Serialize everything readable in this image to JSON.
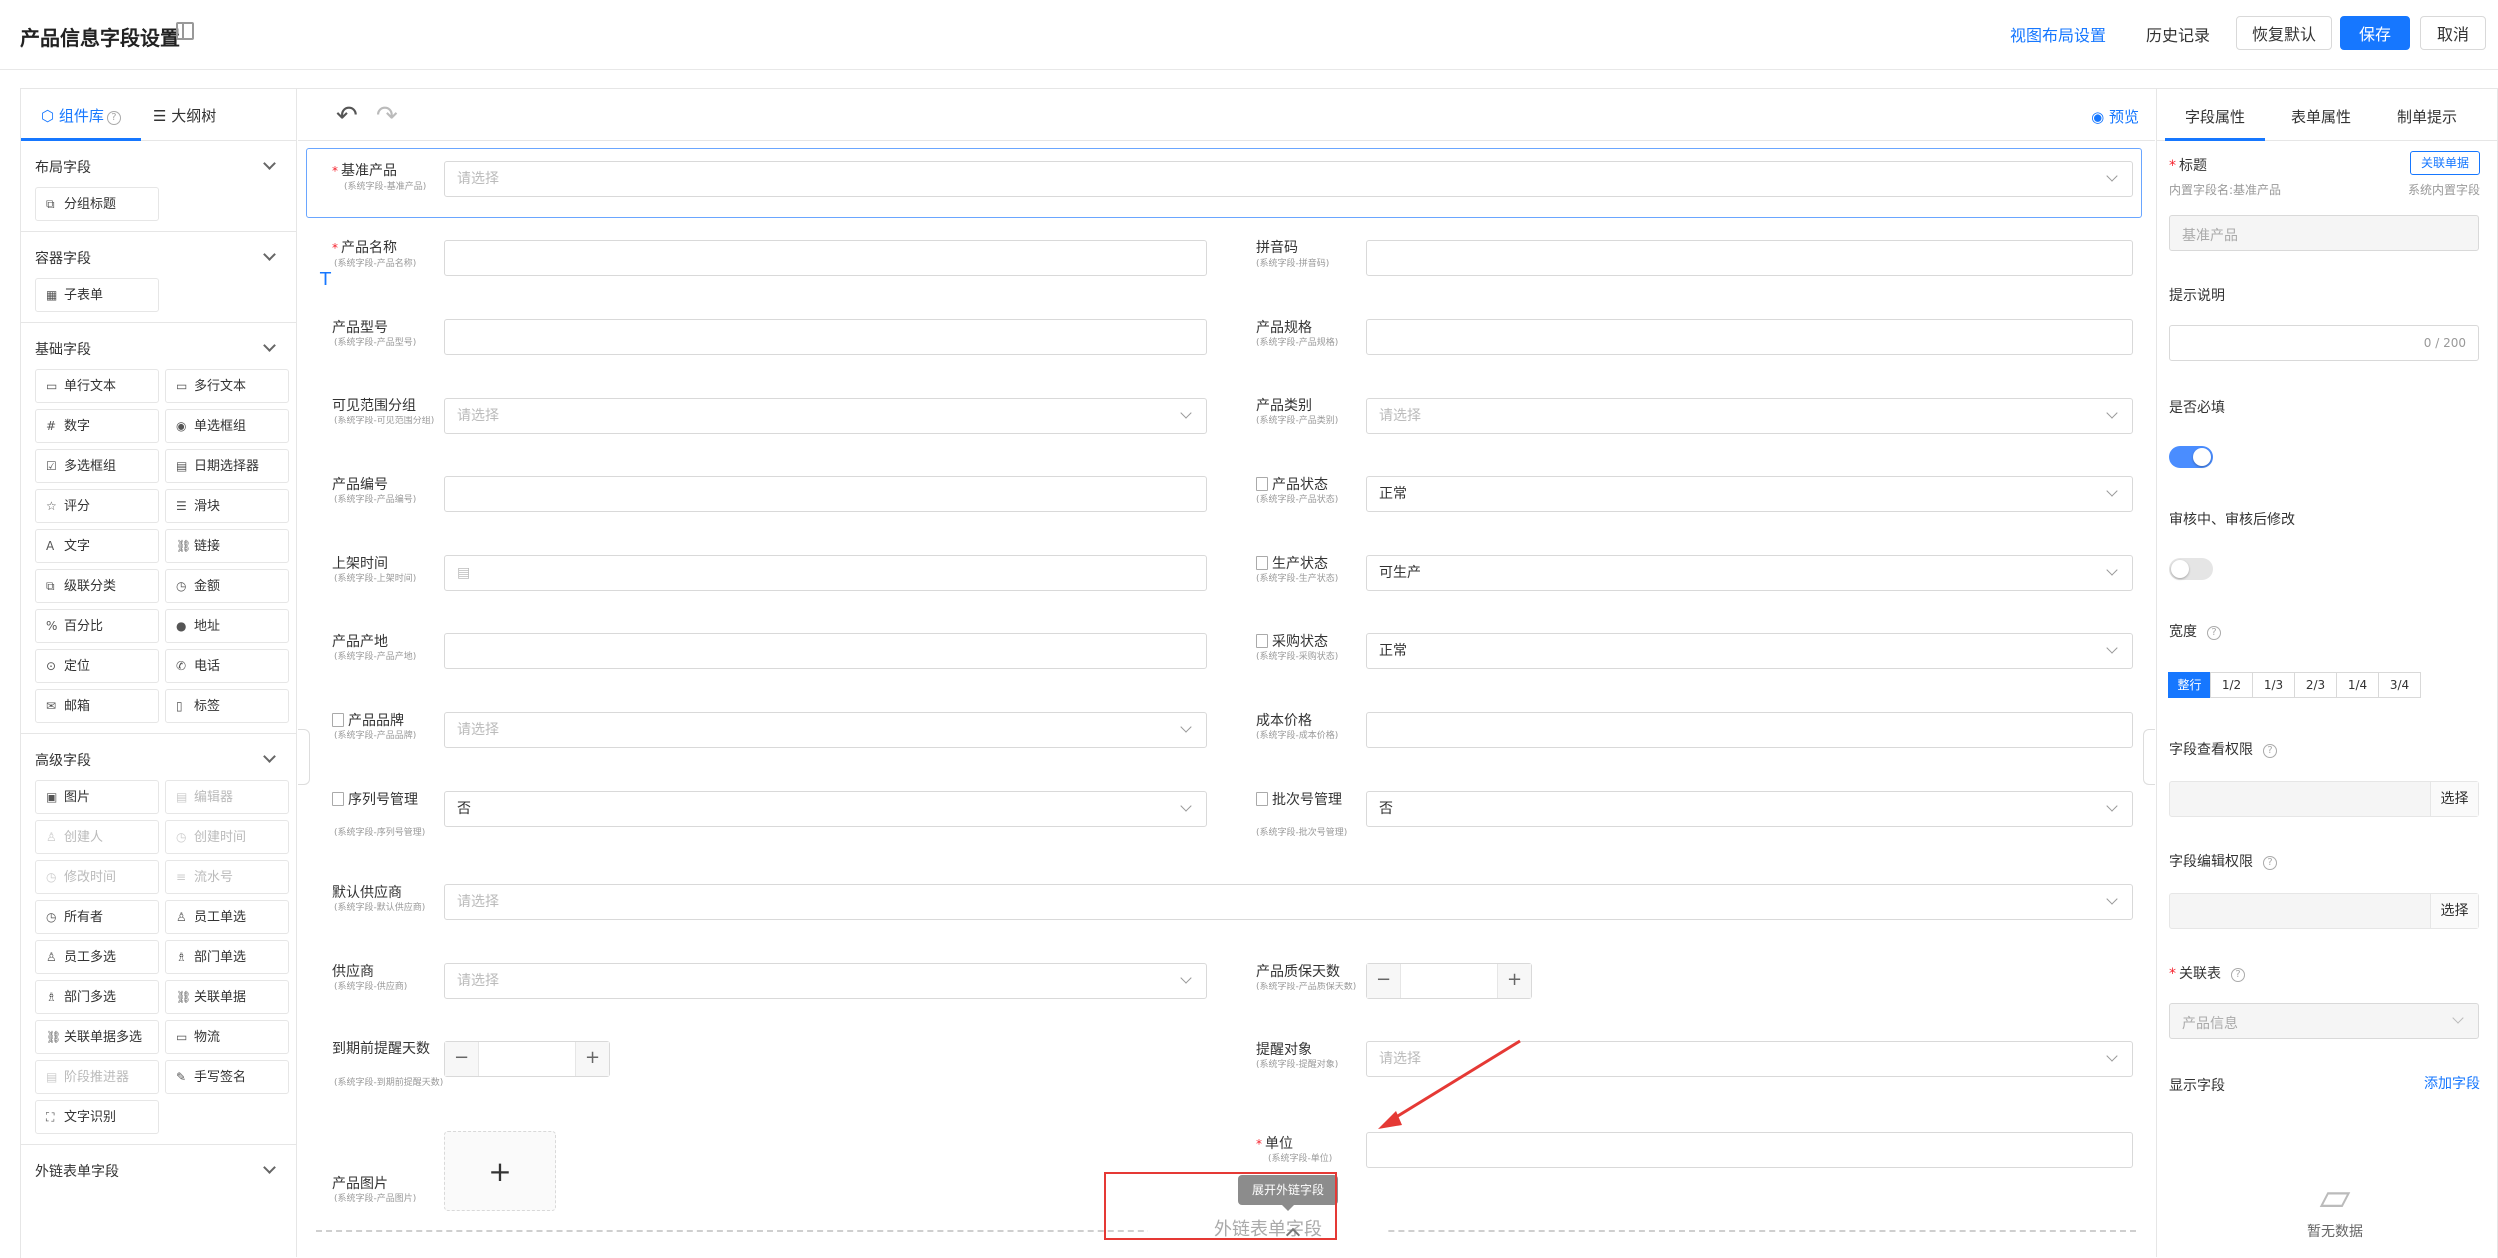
{
  "header": {
    "title": "产品信息字段设置",
    "view_layout": "视图布局设置",
    "history": "历史记录",
    "restore": "恢复默认",
    "save": "保存",
    "cancel": "取消"
  },
  "left": {
    "tabs": [
      "组件库",
      "大纲树"
    ],
    "sections": {
      "layout": {
        "title": "布局字段",
        "items": [
          "分组标题"
        ]
      },
      "container": {
        "title": "容器字段",
        "items": [
          "子表单"
        ]
      },
      "basic": {
        "title": "基础字段",
        "items": [
          "单行文本",
          "多行文本",
          "数字",
          "单选框组",
          "多选框组",
          "日期选择器",
          "评分",
          "滑块",
          "文字",
          "链接",
          "级联分类",
          "金额",
          "百分比",
          "地址",
          "定位",
          "电话",
          "邮箱",
          "标签"
        ]
      },
      "advanced": {
        "title": "高级字段",
        "items": [
          "图片",
          "编辑器",
          "创建人",
          "创建时间",
          "修改时间",
          "流水号",
          "所有者",
          "员工单选",
          "员工多选",
          "部门单选",
          "部门多选",
          "关联单据",
          "关联单据多选",
          "物流",
          "阶段推进器",
          "手写签名",
          "文字识别"
        ]
      },
      "external": {
        "title": "外链表单字段"
      }
    }
  },
  "canvas": {
    "preview": "预览",
    "fields": {
      "base_product": {
        "label": "基准产品",
        "sub": "(系统字段-基准产品)",
        "placeholder": "请选择"
      },
      "product_name": {
        "label": "产品名称",
        "sub": "(系统字段-产品名称)"
      },
      "pinyin": {
        "label": "拼音码",
        "sub": "(系统字段-拼音码)"
      },
      "model": {
        "label": "产品型号",
        "sub": "(系统字段-产品型号)"
      },
      "spec": {
        "label": "产品规格",
        "sub": "(系统字段-产品规格)"
      },
      "visibility": {
        "label": "可见范围分组",
        "sub": "(系统字段-可见范围分组)",
        "placeholder": "请选择"
      },
      "category": {
        "label": "产品类别",
        "sub": "(系统字段-产品类别)",
        "placeholder": "请选择"
      },
      "code": {
        "label": "产品编号",
        "sub": "(系统字段-产品编号)"
      },
      "status": {
        "label": "产品状态",
        "sub": "(系统字段-产品状态)",
        "value": "正常"
      },
      "shelf_time": {
        "label": "上架时间",
        "sub": "(系统字段-上架时间)"
      },
      "production": {
        "label": "生产状态",
        "sub": "(系统字段-生产状态)",
        "value": "可生产"
      },
      "origin": {
        "label": "产品产地",
        "sub": "(系统字段-产品产地)"
      },
      "purchase": {
        "label": "采购状态",
        "sub": "(系统字段-采购状态)",
        "value": "正常"
      },
      "brand": {
        "label": "产品品牌",
        "sub": "(系统字段-产品品牌)",
        "placeholder": "请选择"
      },
      "cost": {
        "label": "成本价格",
        "sub": "(系统字段-成本价格)"
      },
      "serial": {
        "label": "序列号管理",
        "sub": "(系统字段-序列号管理)",
        "value": "否"
      },
      "batch": {
        "label": "批次号管理",
        "sub": "(系统字段-批次号管理)",
        "value": "否"
      },
      "default_supplier": {
        "label": "默认供应商",
        "sub": "(系统字段-默认供应商)",
        "placeholder": "请选择"
      },
      "supplier": {
        "label": "供应商",
        "sub": "(系统字段-供应商)",
        "placeholder": "请选择"
      },
      "warranty": {
        "label": "产品质保天数",
        "sub": "(系统字段-产品质保天数)"
      },
      "remind_days": {
        "label": "到期前提醒天数",
        "sub": "(系统字段-到期前提醒天数)"
      },
      "remind_target": {
        "label": "提醒对象",
        "sub": "(系统字段-提醒对象)",
        "placeholder": "请选择"
      },
      "unit": {
        "label": "单位",
        "sub": "(系统字段-单位)"
      },
      "image": {
        "label": "产品图片",
        "sub": "(系统字段-产品图片)"
      }
    },
    "external_label": "外链表单字段",
    "tooltip": "展开外链字段"
  },
  "right": {
    "tabs": [
      "字段属性",
      "表单属性",
      "制单提示"
    ],
    "title_label": "标题",
    "link_btn": "关联单据",
    "inner_name": "内置字段名:基准产品",
    "sys_field": "系统内置字段",
    "title_value": "基准产品",
    "hint_label": "提示说明",
    "hint_count": "0 / 200",
    "required_label": "是否必填",
    "audit_label": "审核中、审核后修改",
    "width_label": "宽度",
    "widths": [
      "整行",
      "1/2",
      "1/3",
      "2/3",
      "1/4",
      "3/4"
    ],
    "view_perm": "字段查看权限",
    "edit_perm": "字段编辑权限",
    "pick": "选择",
    "rel_table": "关联表",
    "rel_value": "产品信息",
    "display_fields": "显示字段",
    "add_field": "添加字段",
    "empty": "暂无数据"
  },
  "colors": {
    "accent": "#1677ff",
    "annotation": "#e53935"
  }
}
